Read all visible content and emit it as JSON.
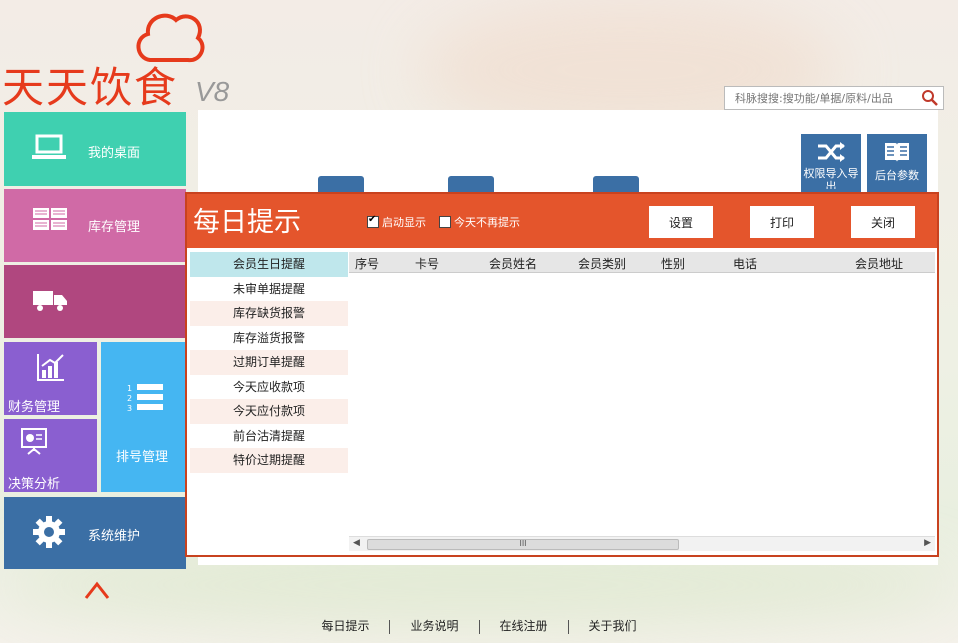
{
  "brand": {
    "name": "天天饮食",
    "version": "V8"
  },
  "search": {
    "placeholder": "科脉搜搜:搜功能/单据/原料/出品"
  },
  "tiles": {
    "desktop": "我的桌面",
    "inventory": "库存管理",
    "finance": "财务管理",
    "decision": "决策分析",
    "queue": "排号管理",
    "system": "系统维护"
  },
  "right_tiles": {
    "guide": "权限导入导出",
    "backend": "后台参数"
  },
  "dialog": {
    "title": "每日提示",
    "show_on_start": "启动显示",
    "no_more_today": "今天不再提示",
    "buttons": {
      "settings": "设置",
      "print": "打印",
      "close": "关闭"
    },
    "menu": [
      "会员生日提醒",
      "未审单据提醒",
      "库存缺货报警",
      "库存溢货报警",
      "过期订单提醒",
      "今天应收款项",
      "今天应付款项",
      "前台沽清提醒",
      "特价过期提醒"
    ],
    "columns": [
      "序号",
      "卡号",
      "会员姓名",
      "会员类别",
      "性别",
      "电话",
      "会员地址"
    ],
    "scroll_thumb": "III"
  },
  "footer": [
    "每日提示",
    "业务说明",
    "在线注册",
    "关于我们"
  ],
  "colors": {
    "accent": "#e4552c",
    "desktop_tile": "#3fd0b0",
    "inventory_tile": "#d06aa6",
    "purple_tile": "#b0477f",
    "finance_tile": "#8a5fd0",
    "queue_tile": "#45b6f2",
    "system_tile": "#3b6fa5"
  }
}
